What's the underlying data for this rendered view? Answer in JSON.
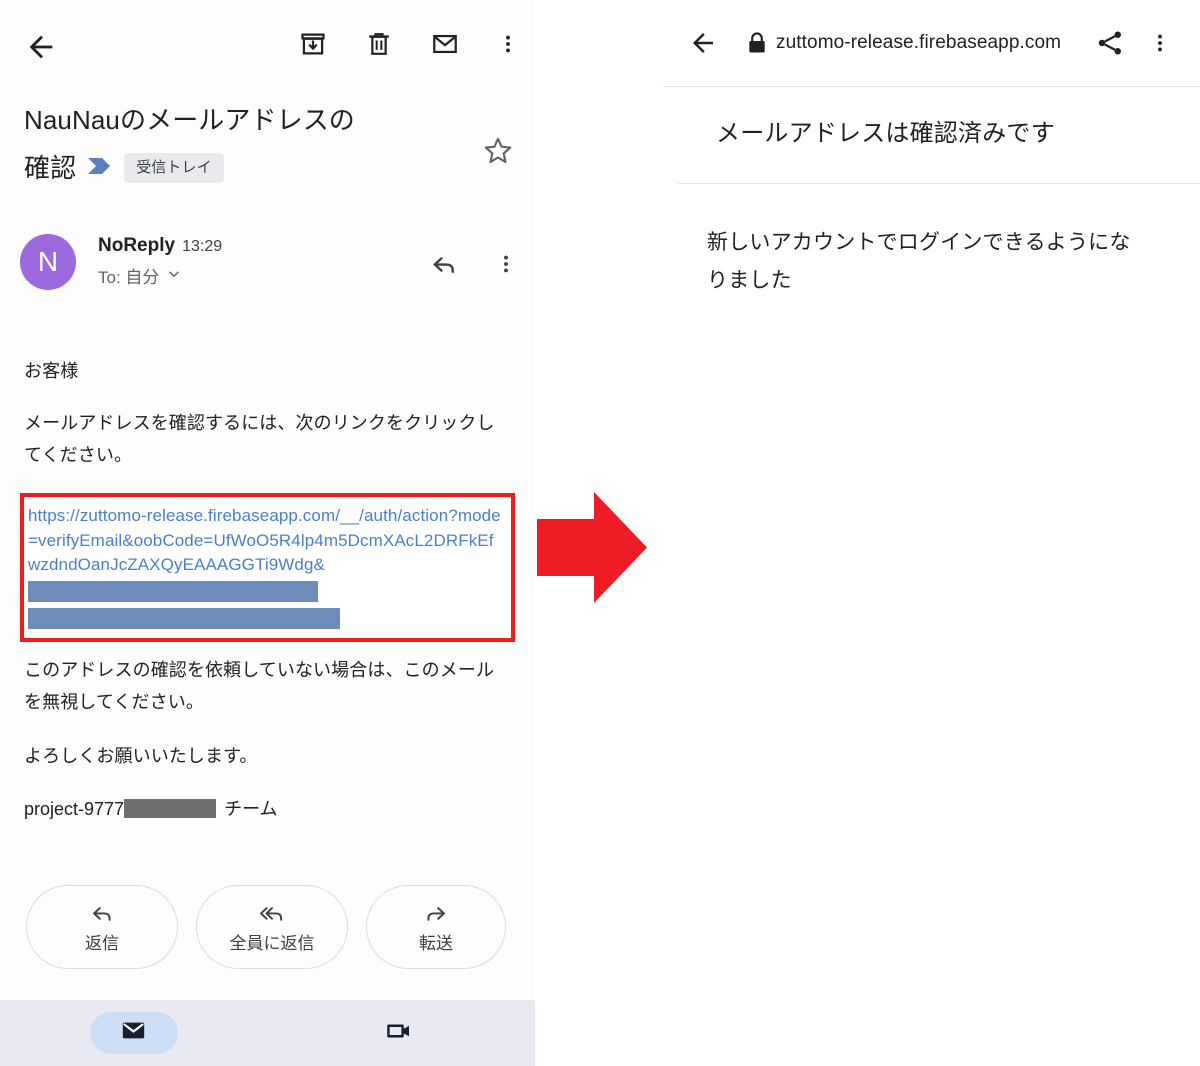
{
  "left_panel": {
    "app": "Gmail",
    "toolbar": {
      "back_label": "戻る",
      "archive_label": "アーカイブ",
      "delete_label": "削除",
      "mark_unread_label": "未読にする",
      "more_label": "その他"
    },
    "email": {
      "subject_line1": "NauNauのメールアドレスの",
      "subject_line2": "確認",
      "label_chip": "受信トレイ",
      "starred": false,
      "star_label": "スター",
      "sender_name": "NoReply",
      "time": "13:29",
      "recipient": "To: 自分",
      "avatar_letter": "N",
      "avatar_color": "#9c6ade",
      "reply_icon_label": "返信",
      "more_icon_label": "その他",
      "body": {
        "greeting": "お客様",
        "instruction": "メールアドレスを確認するには、次のリンクをクリックしてください。",
        "link_lines": [
          "https://zuttomo-release.firebaseapp.com/__/auth/",
          "action?mode=verifyEmail&oobCode=",
          "UfWoO5R4lp4m5DcmXAcL2DRFkEfwzd",
          "ndOanJcZAXQyEAAAGGTi9Wdg&"
        ],
        "link_color": "#4a7fd0",
        "highlight_color": "#f01b1b",
        "redaction_color": "#6e8cba",
        "disclaimer": "このアドレスの確認を依頼していない場合は、このメールを無視してください。",
        "closing": "よろしくお願いいたします。",
        "signature_prefix": "project-9777",
        "signature_suffix": "チーム",
        "signature_redaction_color": "#6f6f6f"
      }
    },
    "reply_buttons": [
      {
        "label": "返信",
        "icon": "reply-icon"
      },
      {
        "label": "全員に返信",
        "icon": "reply-all-icon"
      },
      {
        "label": "転送",
        "icon": "forward-icon"
      }
    ],
    "bottom_nav": [
      {
        "name": "mail",
        "icon": "mail-icon",
        "active": true
      },
      {
        "name": "meet",
        "icon": "video-camera-icon",
        "active": false
      }
    ]
  },
  "arrow": {
    "direction": "right",
    "color": "#ee1c25"
  },
  "right_panel": {
    "app": "Chrome Custom Tab",
    "toolbar": {
      "back_label": "戻る",
      "secure_label": "安全な接続",
      "url": "zuttomo-release.firebaseapp.com",
      "share_label": "共有",
      "more_label": "その他"
    },
    "page": {
      "heading": "メールアドレスは確認済みです",
      "body": "新しいアカウントでログインできるようになりました"
    }
  }
}
